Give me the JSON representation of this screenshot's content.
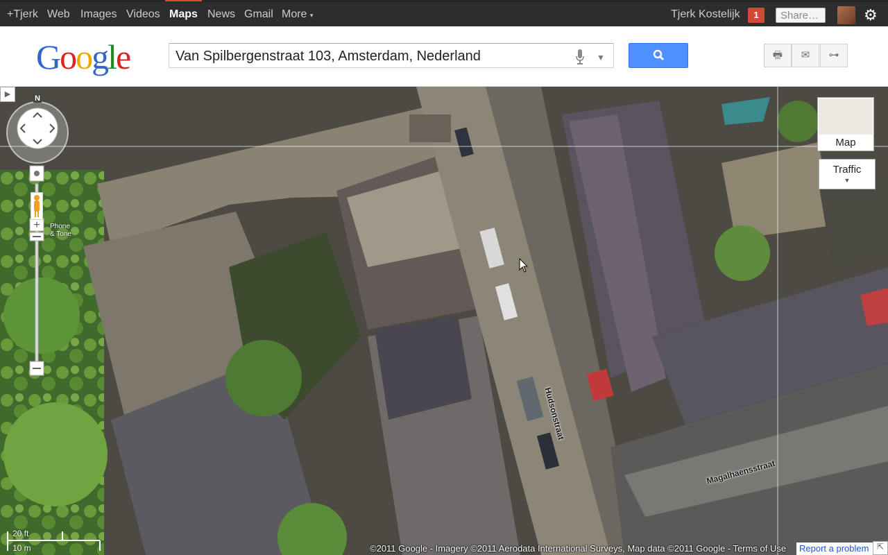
{
  "topbar": {
    "nav": [
      "+Tjerk",
      "Web",
      "Images",
      "Videos",
      "Maps",
      "News",
      "Gmail",
      "More"
    ],
    "active": "Maps",
    "user_name": "Tjerk Kostelijk",
    "notification_count": "1",
    "share_label": "Share…"
  },
  "header": {
    "logo": "Google",
    "search_value": "Van Spilbergenstraat 103, Amsterdam, Nederland"
  },
  "map": {
    "compass_north": "N",
    "pegman_tooltip": [
      "Phone",
      "& Tone"
    ],
    "map_type_label": "Map",
    "traffic_label": "Traffic",
    "scale": {
      "imperial": "20 ft",
      "metric": "10 m"
    },
    "streets": [
      "Hudsonstraat",
      "Magalhaensstraat"
    ],
    "copyright": "©2011 Google - Imagery ©2011 Aerodata International Surveys, Map data ©2011 Google - Terms of Use",
    "report_problem": "Report a problem"
  },
  "colors": {
    "accent": "#4d90fe",
    "active_nav": "#dd4b39",
    "notification": "#d14836"
  }
}
